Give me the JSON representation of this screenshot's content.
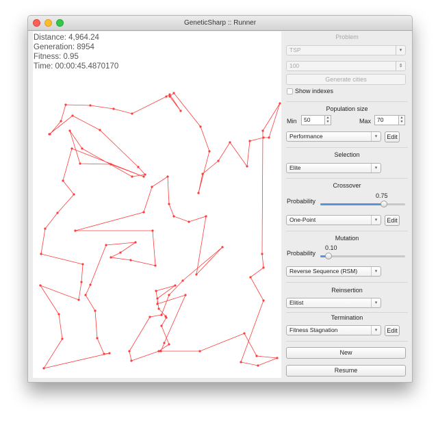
{
  "window": {
    "title": "GeneticSharp :: Runner"
  },
  "stats": {
    "distance": "Distance: 4,964.24",
    "generation": "Generation: 8954",
    "fitness": "Fitness: 0.95",
    "time": "Time: 00:00:45.4870170"
  },
  "problem": {
    "title": "Problem",
    "selected": "TSP",
    "cities_count": "100",
    "generate_label": "Generate cities",
    "show_indexes_label": "Show indexes"
  },
  "population": {
    "title": "Population size",
    "min_label": "Min",
    "min_value": "50",
    "max_label": "Max",
    "max_value": "70",
    "type": "Performance",
    "edit_label": "Edit"
  },
  "selection": {
    "title": "Selection",
    "selected": "Elite"
  },
  "crossover": {
    "title": "Crossover",
    "probability_label": "Probability",
    "probability_value": "0.75",
    "probability": 0.75,
    "selected": "One-Point",
    "edit_label": "Edit"
  },
  "mutation": {
    "title": "Mutation",
    "probability_label": "Probability",
    "probability_value": "0.10",
    "probability": 0.1,
    "selected": "Reverse Sequence (RSM)"
  },
  "reinsertion": {
    "title": "Reinsertion",
    "selected": "Elitist"
  },
  "termination": {
    "title": "Termination",
    "selected": "Fitness Stagnation",
    "edit_label": "Edit"
  },
  "actions": {
    "new_label": "New",
    "resume_label": "Resume"
  },
  "colors": {
    "route": "#ff3b3b",
    "slider_fill": "#5b92dc"
  }
}
